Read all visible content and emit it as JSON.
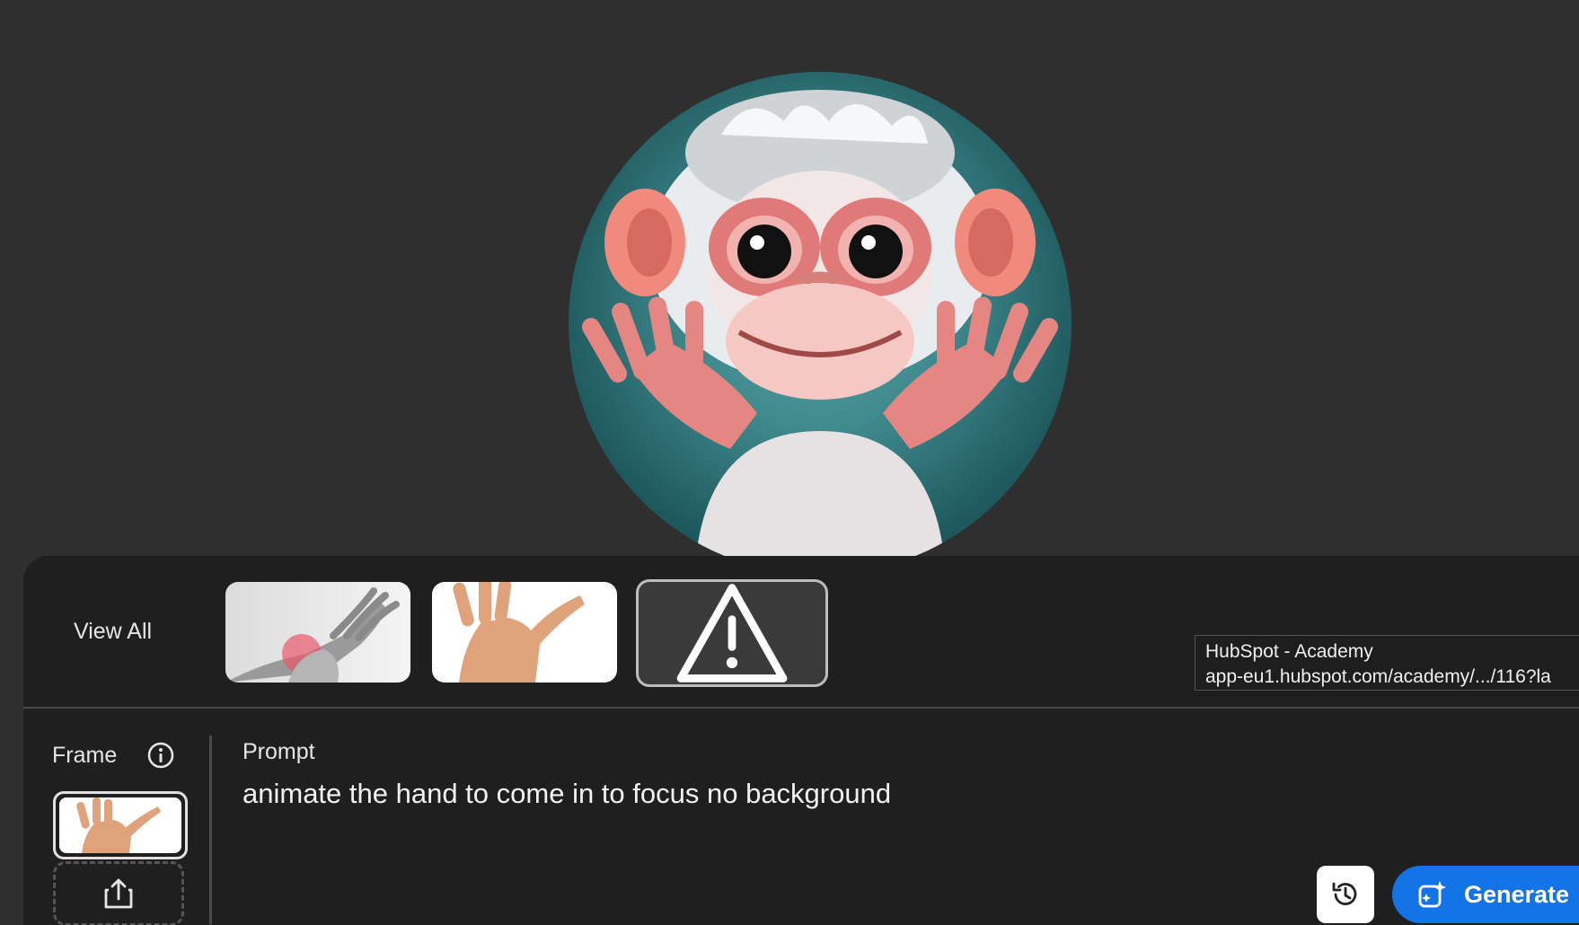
{
  "gallery": {
    "view_all_label": "View All",
    "thumbnails": [
      {
        "name": "hand-wrist-pain-thumbnail"
      },
      {
        "name": "raised-hand-thumbnail"
      },
      {
        "name": "warning-thumbnail",
        "icon": "warning-icon"
      }
    ]
  },
  "tooltip": {
    "title": "HubSpot - Academy",
    "url": "app-eu1.hubspot.com/academy/.../116?la"
  },
  "frame": {
    "label": "Frame",
    "info_icon": "info-icon",
    "upload_icon": "upload-icon"
  },
  "prompt": {
    "label": "Prompt",
    "value": "animate the hand to come in to focus no background"
  },
  "actions": {
    "history_icon": "history-icon",
    "generate_label": "Generate",
    "generate_icon": "generate-sparkle-icon"
  },
  "colors": {
    "background": "#2f2f2f",
    "panel": "#1f1f1f",
    "accent": "#1473e6"
  }
}
